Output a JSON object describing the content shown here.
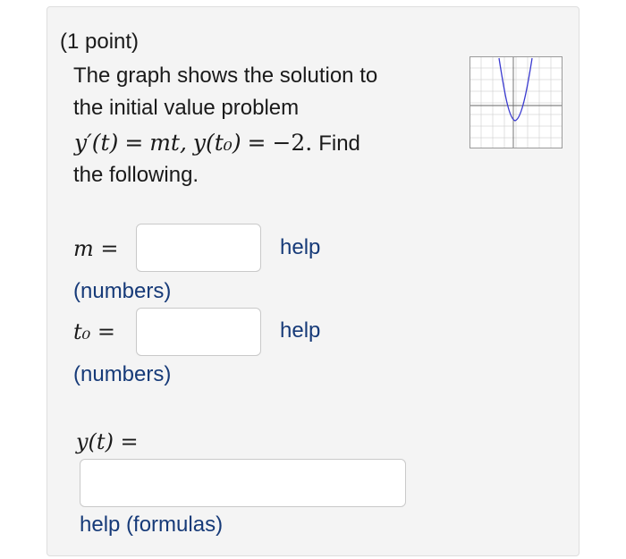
{
  "problem": {
    "points": "(1 point)",
    "intro_line1": "The graph shows the solution to",
    "intro_line2": "the initial value problem",
    "find": "Find",
    "following": "the following."
  },
  "equation": {
    "y_prime_t": "y′(t)",
    "eq1": "=",
    "mt": "mt,",
    "y_t0": "y(t₀)",
    "eq2": "=",
    "value": "−2."
  },
  "fields": {
    "m_label": "m =",
    "t0_label": "t₀ =",
    "yt_label": "y(t) =",
    "m_value": "",
    "t0_value": "",
    "yt_value": "",
    "numbers_note": "(numbers)",
    "help": "help",
    "help_formulas": "help (formulas)"
  },
  "graph": {
    "curve_color": "#3b3bd0",
    "grid_color": "#d6d6d6",
    "axis_color": "#666666"
  }
}
